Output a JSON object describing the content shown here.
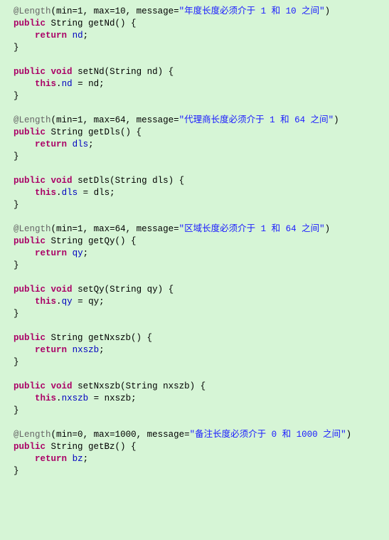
{
  "lines": [
    [
      {
        "cls": "ann",
        "t": "@Length"
      },
      {
        "cls": "pun",
        "t": "(min="
      },
      {
        "cls": "pun",
        "t": "1"
      },
      {
        "cls": "pun",
        "t": ", max="
      },
      {
        "cls": "pun",
        "t": "10"
      },
      {
        "cls": "pun",
        "t": ", message="
      },
      {
        "cls": "str",
        "t": "\"年度长度必须介于 1 和 10 之间\""
      },
      {
        "cls": "pun",
        "t": ")"
      }
    ],
    [
      {
        "cls": "kw",
        "t": "public"
      },
      {
        "cls": "pun",
        "t": " String getNd() {"
      }
    ],
    [
      {
        "cls": "pun",
        "t": "    "
      },
      {
        "cls": "kw",
        "t": "return"
      },
      {
        "cls": "pun",
        "t": " "
      },
      {
        "cls": "field",
        "t": "nd"
      },
      {
        "cls": "pun",
        "t": ";"
      }
    ],
    [
      {
        "cls": "pun",
        "t": "}"
      }
    ],
    [],
    [
      {
        "cls": "kw",
        "t": "public"
      },
      {
        "cls": "pun",
        "t": " "
      },
      {
        "cls": "kw",
        "t": "void"
      },
      {
        "cls": "pun",
        "t": " setNd(String nd) {"
      }
    ],
    [
      {
        "cls": "pun",
        "t": "    "
      },
      {
        "cls": "kw",
        "t": "this"
      },
      {
        "cls": "pun",
        "t": "."
      },
      {
        "cls": "field",
        "t": "nd"
      },
      {
        "cls": "pun",
        "t": " = nd;"
      }
    ],
    [
      {
        "cls": "pun",
        "t": "}"
      }
    ],
    [],
    [
      {
        "cls": "ann",
        "t": "@Length"
      },
      {
        "cls": "pun",
        "t": "(min="
      },
      {
        "cls": "pun",
        "t": "1"
      },
      {
        "cls": "pun",
        "t": ", max="
      },
      {
        "cls": "pun",
        "t": "64"
      },
      {
        "cls": "pun",
        "t": ", message="
      },
      {
        "cls": "str",
        "t": "\"代理商长度必须介于 1 和 64 之间\""
      },
      {
        "cls": "pun",
        "t": ")"
      }
    ],
    [
      {
        "cls": "kw",
        "t": "public"
      },
      {
        "cls": "pun",
        "t": " String getDls() {"
      }
    ],
    [
      {
        "cls": "pun",
        "t": "    "
      },
      {
        "cls": "kw",
        "t": "return"
      },
      {
        "cls": "pun",
        "t": " "
      },
      {
        "cls": "field",
        "t": "dls"
      },
      {
        "cls": "pun",
        "t": ";"
      }
    ],
    [
      {
        "cls": "pun",
        "t": "}"
      }
    ],
    [],
    [
      {
        "cls": "kw",
        "t": "public"
      },
      {
        "cls": "pun",
        "t": " "
      },
      {
        "cls": "kw",
        "t": "void"
      },
      {
        "cls": "pun",
        "t": " setDls(String dls) {"
      }
    ],
    [
      {
        "cls": "pun",
        "t": "    "
      },
      {
        "cls": "kw",
        "t": "this"
      },
      {
        "cls": "pun",
        "t": "."
      },
      {
        "cls": "field",
        "t": "dls"
      },
      {
        "cls": "pun",
        "t": " = dls;"
      }
    ],
    [
      {
        "cls": "pun",
        "t": "}"
      }
    ],
    [],
    [
      {
        "cls": "ann",
        "t": "@Length"
      },
      {
        "cls": "pun",
        "t": "(min="
      },
      {
        "cls": "pun",
        "t": "1"
      },
      {
        "cls": "pun",
        "t": ", max="
      },
      {
        "cls": "pun",
        "t": "64"
      },
      {
        "cls": "pun",
        "t": ", message="
      },
      {
        "cls": "str",
        "t": "\"区域长度必须介于 1 和 64 之间\""
      },
      {
        "cls": "pun",
        "t": ")"
      }
    ],
    [
      {
        "cls": "kw",
        "t": "public"
      },
      {
        "cls": "pun",
        "t": " String getQy() {"
      }
    ],
    [
      {
        "cls": "pun",
        "t": "    "
      },
      {
        "cls": "kw",
        "t": "return"
      },
      {
        "cls": "pun",
        "t": " "
      },
      {
        "cls": "field",
        "t": "qy"
      },
      {
        "cls": "pun",
        "t": ";"
      }
    ],
    [
      {
        "cls": "pun",
        "t": "}"
      }
    ],
    [],
    [
      {
        "cls": "kw",
        "t": "public"
      },
      {
        "cls": "pun",
        "t": " "
      },
      {
        "cls": "kw",
        "t": "void"
      },
      {
        "cls": "pun",
        "t": " setQy(String qy) {"
      }
    ],
    [
      {
        "cls": "pun",
        "t": "    "
      },
      {
        "cls": "kw",
        "t": "this"
      },
      {
        "cls": "pun",
        "t": "."
      },
      {
        "cls": "field",
        "t": "qy"
      },
      {
        "cls": "pun",
        "t": " = qy;"
      }
    ],
    [
      {
        "cls": "pun",
        "t": "}"
      }
    ],
    [],
    [
      {
        "cls": "kw",
        "t": "public"
      },
      {
        "cls": "pun",
        "t": " String getNxszb() {"
      }
    ],
    [
      {
        "cls": "pun",
        "t": "    "
      },
      {
        "cls": "kw",
        "t": "return"
      },
      {
        "cls": "pun",
        "t": " "
      },
      {
        "cls": "field",
        "t": "nxszb"
      },
      {
        "cls": "pun",
        "t": ";"
      }
    ],
    [
      {
        "cls": "pun",
        "t": "}"
      }
    ],
    [],
    [
      {
        "cls": "kw",
        "t": "public"
      },
      {
        "cls": "pun",
        "t": " "
      },
      {
        "cls": "kw",
        "t": "void"
      },
      {
        "cls": "pun",
        "t": " setNxszb(String nxszb) {"
      }
    ],
    [
      {
        "cls": "pun",
        "t": "    "
      },
      {
        "cls": "kw",
        "t": "this"
      },
      {
        "cls": "pun",
        "t": "."
      },
      {
        "cls": "field",
        "t": "nxszb"
      },
      {
        "cls": "pun",
        "t": " = nxszb;"
      }
    ],
    [
      {
        "cls": "pun",
        "t": "}"
      }
    ],
    [],
    [
      {
        "cls": "ann",
        "t": "@Length"
      },
      {
        "cls": "pun",
        "t": "(min="
      },
      {
        "cls": "pun",
        "t": "0"
      },
      {
        "cls": "pun",
        "t": ", max="
      },
      {
        "cls": "pun",
        "t": "1000"
      },
      {
        "cls": "pun",
        "t": ", message="
      },
      {
        "cls": "str",
        "t": "\"备注长度必须介于 0 和 1000 之间\""
      },
      {
        "cls": "pun",
        "t": ")"
      }
    ],
    [
      {
        "cls": "kw",
        "t": "public"
      },
      {
        "cls": "pun",
        "t": " String getBz() {"
      }
    ],
    [
      {
        "cls": "pun",
        "t": "    "
      },
      {
        "cls": "kw",
        "t": "return"
      },
      {
        "cls": "pun",
        "t": " "
      },
      {
        "cls": "field",
        "t": "bz"
      },
      {
        "cls": "pun",
        "t": ";"
      }
    ],
    [
      {
        "cls": "pun",
        "t": "}"
      }
    ]
  ],
  "indent": "  "
}
